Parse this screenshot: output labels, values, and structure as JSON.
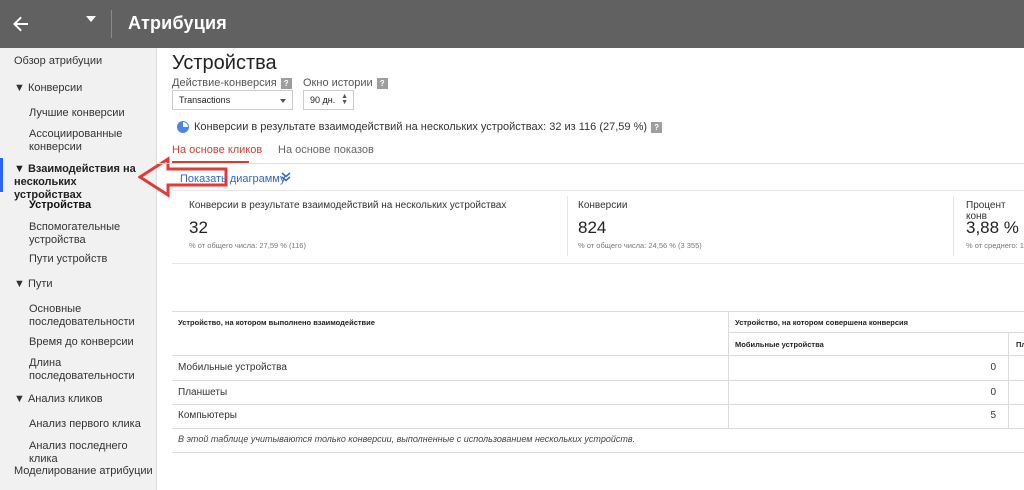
{
  "topbar": {
    "title": "Атрибуция",
    "back_icon": "arrow-left-icon"
  },
  "sidebar": {
    "overview": "Обзор атрибуции",
    "conversions_group": "▼ Конверсии",
    "top_conversions": "Лучшие конверсии",
    "assisted_conversions": "Ассоциированные конверсии",
    "cross_device_group": "▼ Взаимодействия на нескольких устройствах",
    "devices": "Устройства",
    "assisting_devices": "Вспомогательные устройства",
    "device_paths": "Пути устройств",
    "paths_group": "▼ Пути",
    "top_paths": "Основные последовательности",
    "time_lag": "Время до конверсии",
    "path_length": "Длина последовательности",
    "clicks_group": "▼ Анализ кликов",
    "first_click": "Анализ первого клика",
    "last_click": "Анализ последнего клика",
    "modeling": "Моделирование атрибуции"
  },
  "page": {
    "title": "Устройства",
    "conversion_action_label": "Действие-конверсия",
    "conversion_action_value": "Transactions",
    "lookback_label": "Окно истории",
    "lookback_value": "90 дн.",
    "help_glyph": "?",
    "summary": "Конверсии в результате взаимодействий на нескольких устройствах: 32 из 116 (27,59 %)"
  },
  "tabs": {
    "clicks": "На основе кликов",
    "impressions": "На основе показов"
  },
  "show_chart": "Показать диаграмму",
  "metrics": [
    {
      "label": "Конверсии в результате взаимодействий на нескольких устройствах",
      "value": "32",
      "sub": "% от общего числа: 27,59 % (116)"
    },
    {
      "label": "Конверсии",
      "value": "824",
      "sub": "% от общего числа: 24,56 % (3 355)"
    },
    {
      "label": "Процент конв",
      "value": "3,88 %",
      "sub": "% от среднего: 1"
    }
  ],
  "table": {
    "col_interaction": "Устройство, на котором выполнено взаимодействие",
    "col_conversion": "Устройство, на котором совершена конверсия",
    "subcol_mobile": "Мобильные устройства",
    "subcol_cut": "Пл",
    "rows": [
      {
        "label": "Мобильные устройства",
        "value": "0"
      },
      {
        "label": "Планшеты",
        "value": "0"
      },
      {
        "label": "Компьютеры",
        "value": "5"
      }
    ],
    "note": "В этой таблице учитываются только конверсии, выполненные с использованием нескольких устройств."
  },
  "colors": {
    "topbar": "#616161",
    "accent_tab": "#d23f31",
    "link": "#3366cc",
    "arrow": "#e53935"
  }
}
